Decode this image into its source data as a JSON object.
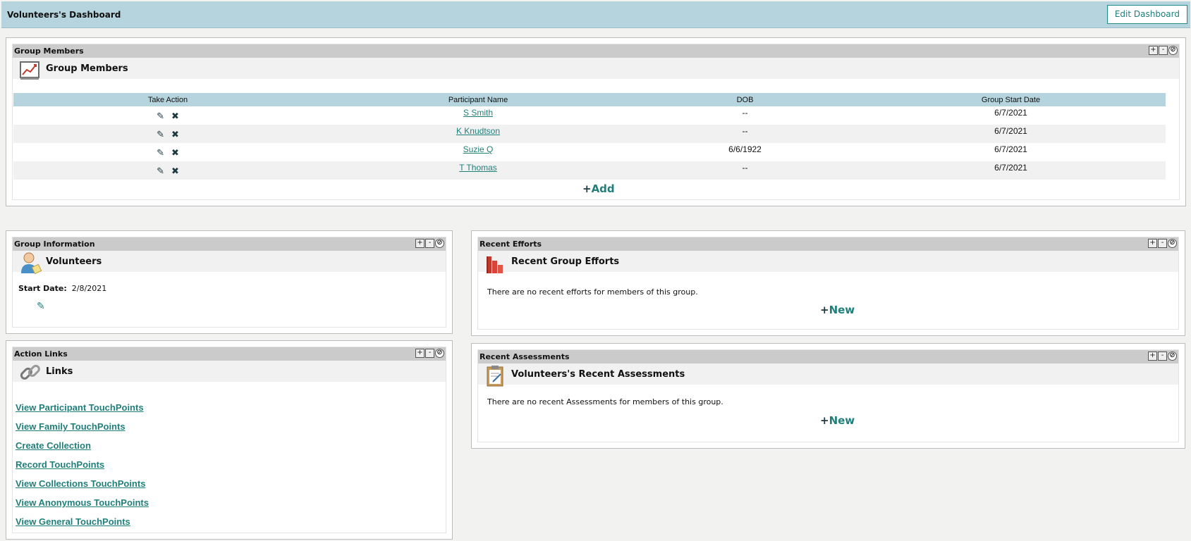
{
  "header": {
    "title": "Volunteers's Dashboard",
    "edit_button": "Edit Dashboard"
  },
  "group_members": {
    "panel_title": "Group Members",
    "subtitle": "Group Members",
    "icon": "chart-icon",
    "columns": [
      "Take Action",
      "Participant Name",
      "DOB",
      "Group Start Date"
    ],
    "rows": [
      {
        "name": "S Smith",
        "dob": "--",
        "start": "6/7/2021"
      },
      {
        "name": "K Knudtson",
        "dob": "--",
        "start": "6/7/2021"
      },
      {
        "name": "Suzie Q",
        "dob": "6/6/1922",
        "start": "6/7/2021"
      },
      {
        "name": "T Thomas",
        "dob": "--",
        "start": "6/7/2021"
      }
    ],
    "add_label": "Add",
    "add_symbol": "+"
  },
  "group_information": {
    "panel_title": "Group Information",
    "subtitle": "Volunteers",
    "icon": "user-icon",
    "start_label": "Start Date:",
    "start_value": "2/8/2021"
  },
  "action_links": {
    "panel_title": "Action Links",
    "subtitle": "Links",
    "icon": "link-icon",
    "links": [
      "View Participant TouchPoints",
      "View Family TouchPoints",
      "Create Collection",
      "Record TouchPoints",
      "View Collections TouchPoints",
      "View Anonymous TouchPoints",
      "View General TouchPoints"
    ]
  },
  "recent_efforts": {
    "panel_title": "Recent Efforts",
    "subtitle": "Recent Group Efforts",
    "icon": "bar-chart-icon",
    "message": "There are no recent efforts for members of this group.",
    "new_label": "New",
    "new_symbol": "+"
  },
  "recent_assessments": {
    "panel_title": "Recent Assessments",
    "subtitle": "Volunteers's Recent Assessments",
    "icon": "clipboard-icon",
    "message": "There are no recent Assessments for members of this group.",
    "new_label": "New",
    "new_symbol": "+"
  },
  "panel_controls": {
    "expand": "+",
    "collapse": "-",
    "close": "⊘"
  },
  "colors": {
    "accent": "#1f7f7a",
    "header_bg": "#b5d4dd",
    "panel_head": "#cbcbcb"
  }
}
